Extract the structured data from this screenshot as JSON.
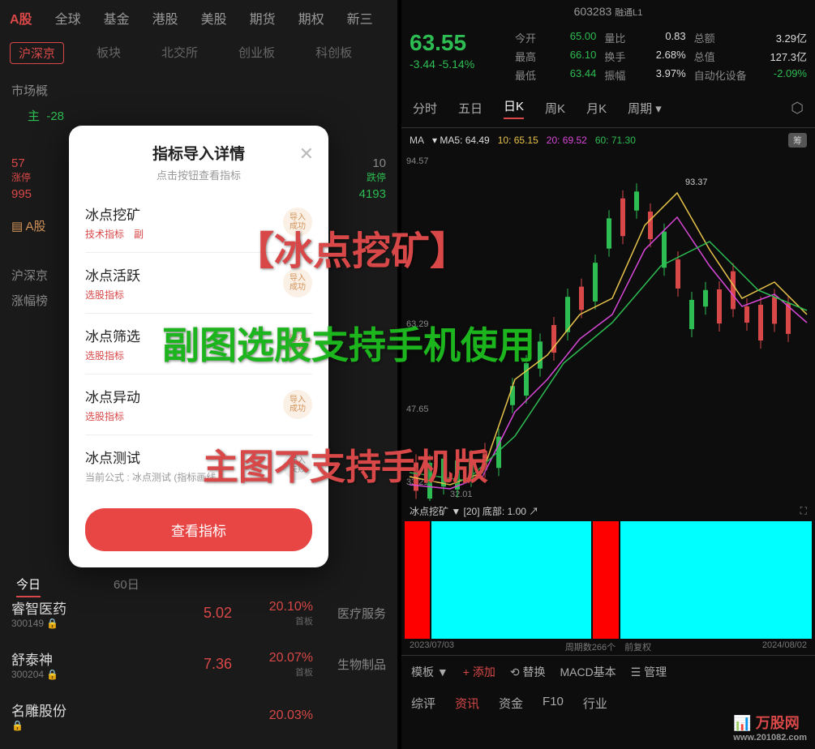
{
  "left": {
    "topTabs": [
      "A股",
      "全球",
      "基金",
      "港股",
      "美股",
      "期货",
      "期权",
      "新三"
    ],
    "subTabs": [
      "沪深京",
      "板块",
      "北交所",
      "创业板",
      "科创板"
    ],
    "marketLabel": "市场概",
    "mainVal": "-28",
    "stat1": "57",
    "stat2": "995",
    "stat3": "10",
    "stat4": "4193",
    "limitUp": "涨停",
    "limitDown": "跌停",
    "rankLabel": "涨幅榜",
    "periodTabs": [
      "今日",
      "",
      "",
      "60日"
    ],
    "stocks": [
      {
        "name": "睿智医药",
        "code": "300149",
        "price": "5.02",
        "pct": "20.10%",
        "tag": "首板",
        "cat": "医疗服务"
      },
      {
        "name": "舒泰神",
        "code": "300204",
        "price": "7.36",
        "pct": "20.07%",
        "tag": "首板",
        "cat": "生物制品"
      },
      {
        "name": "名雕股份",
        "code": "",
        "price": "",
        "pct": "20.03%",
        "tag": "",
        "cat": ""
      }
    ]
  },
  "modal": {
    "title": "指标导入详情",
    "subtitle": "点击按钮查看指标",
    "items": [
      {
        "name": "冰点挖矿",
        "tag": "技术指标　副",
        "badge": "导入成功",
        "ok": true
      },
      {
        "name": "冰点活跃",
        "tag": "选股指标",
        "badge": "导入成功",
        "ok": true
      },
      {
        "name": "冰点筛选",
        "tag": "选股指标",
        "badge": "导入成功",
        "ok": true
      },
      {
        "name": "冰点异动",
        "tag": "选股指标",
        "badge": "导入成功",
        "ok": true
      },
      {
        "name": "冰点测试",
        "sub": "当前公式 : 冰点测试 (指标画线...",
        "badge": "导入失败",
        "ok": false
      }
    ],
    "button": "查看指标"
  },
  "right": {
    "code": "603283",
    "codeTag": "融通L1",
    "price": "63.55",
    "change": "-3.44 -5.14%",
    "quotes": [
      {
        "l": "今开",
        "v": "65.00",
        "c": "grn"
      },
      {
        "l": "量比",
        "v": "0.83",
        "c": "wht"
      },
      {
        "l": "总额",
        "v": "3.29亿",
        "c": "wht"
      },
      {
        "l": "最高",
        "v": "66.10",
        "c": "grn"
      },
      {
        "l": "换手",
        "v": "2.68%",
        "c": "wht"
      },
      {
        "l": "总值",
        "v": "127.3亿",
        "c": "wht"
      },
      {
        "l": "最低",
        "v": "63.44",
        "c": "grn"
      },
      {
        "l": "振幅",
        "v": "3.97%",
        "c": "wht"
      },
      {
        "l": "自动化设备",
        "v": "-2.09%",
        "c": "grn"
      }
    ],
    "kTabs": [
      "分时",
      "五日",
      "日K",
      "周K",
      "月K",
      "周期"
    ],
    "ma": {
      "label": "MA",
      "ma5": "MA5: 64.49",
      "ma10": "10: 65.15",
      "ma20": "20: 69.52",
      "ma60": "60: 71.30",
      "badge": "筹"
    },
    "chartHigh": "94.57",
    "chartPeak": "93.37",
    "chartMid": "63.29",
    "chartMid2": "47.65",
    "chartLow": "33.21",
    "chartLow2": "32.01",
    "indName": "冰点挖矿 ▼ [20] 底部: 1.00 ↗",
    "dates": {
      "start": "2023/07/03",
      "mid": "周期数266个　前复权",
      "end": "2024/08/02"
    },
    "bottomBar": [
      "模板 ▼",
      "添加",
      "替换",
      "MACD基本",
      "管理"
    ],
    "bottomBar2": [
      "综评",
      "资讯",
      "资金",
      "F10",
      "行业"
    ]
  },
  "overlay": {
    "t1": "【冰点挖矿】",
    "t2": "副图选股支持手机使用",
    "t3": "主图不支持手机版"
  },
  "watermark": {
    "name": "万股网",
    "url": "www.201082.com"
  }
}
